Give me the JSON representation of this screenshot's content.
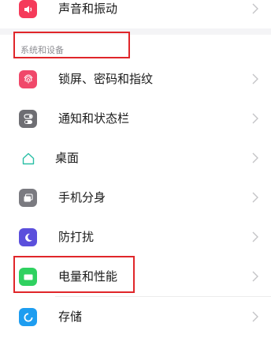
{
  "settings": {
    "top_item": {
      "label": "声音和振动",
      "icon": "speaker-icon",
      "color": "#f53a5a"
    },
    "section_title": "系统和设备",
    "items": [
      {
        "label": "锁屏、密码和指纹",
        "icon": "fingerprint-icon",
        "color": "#f0486a"
      },
      {
        "label": "通知和状态栏",
        "icon": "toggle-icon",
        "color": "#6e6e73"
      },
      {
        "label": "桌面",
        "icon": "home-icon",
        "color": "#2bbfa6"
      },
      {
        "label": "手机分身",
        "icon": "dual-phone-icon",
        "color": "#7a7a80"
      },
      {
        "label": "防打扰",
        "icon": "moon-icon",
        "color": "#5b4fdc"
      },
      {
        "label": "电量和性能",
        "icon": "battery-icon",
        "color": "#2fd160"
      },
      {
        "label": "存储",
        "icon": "storage-icon",
        "color": "#1e9df0"
      }
    ]
  },
  "highlight_color": "#e0262a"
}
